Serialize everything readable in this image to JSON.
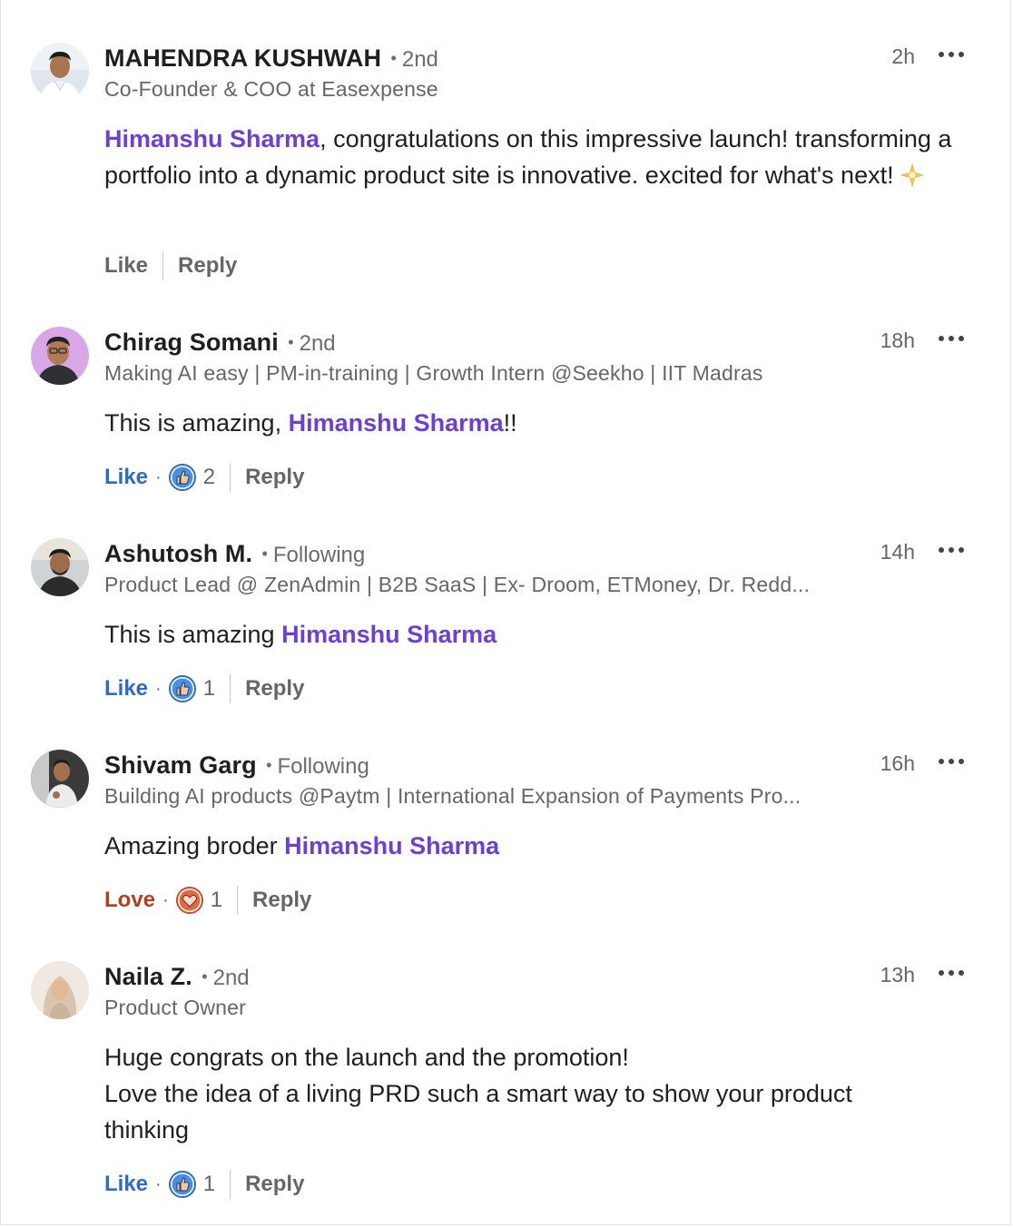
{
  "mention_name": "Himanshu Sharma",
  "colors": {
    "mention": "#6e3fd1",
    "like_active": "#2d6bc4",
    "love_active": "#b24020",
    "muted": "#666666"
  },
  "comments": [
    {
      "name": "MAHENDRA KUSHWAH",
      "degree": "2nd",
      "headline": "Co-Founder & COO at Easexpense",
      "time": "2h",
      "text_before": "",
      "text_after": ", congratulations on this impressive launch! transforming a portfolio into a dynamic product site is innovative. excited for what's next!",
      "emoji": "sparkle-star-icon",
      "reaction_label": "Like",
      "reaction_state": "none",
      "reaction_count": "",
      "reply_label": "Reply"
    },
    {
      "name": "Chirag Somani",
      "degree": "2nd",
      "headline": "Making AI easy | PM-in-training | Growth Intern @Seekho | IIT Madras",
      "time": "18h",
      "text_before": "This is amazing, ",
      "text_after": "!!",
      "reaction_label": "Like",
      "reaction_state": "like",
      "reaction_count": "2",
      "reply_label": "Reply"
    },
    {
      "name": "Ashutosh M.",
      "degree": "Following",
      "headline": "Product Lead @ ZenAdmin | B2B SaaS | Ex- Droom, ETMoney, Dr. Redd...",
      "time": "14h",
      "text_before": "This is amazing ",
      "text_after": "",
      "reaction_label": "Like",
      "reaction_state": "like",
      "reaction_count": "1",
      "reply_label": "Reply"
    },
    {
      "name": "Shivam Garg",
      "degree": "Following",
      "headline": "Building AI products @Paytm | International Expansion of Payments Pro...",
      "time": "16h",
      "text_before": "Amazing broder ",
      "text_after": "",
      "reaction_label": "Love",
      "reaction_state": "love",
      "reaction_count": "1",
      "reply_label": "Reply"
    },
    {
      "name": "Naila Z.",
      "degree": "2nd",
      "headline": "Product Owner",
      "time": "13h",
      "text_line1": "Huge congrats on the launch and the promotion!",
      "text_line2": "Love the idea of a living PRD such a smart way to show your product thinking",
      "reaction_label": "Like",
      "reaction_state": "like",
      "reaction_count": "1",
      "reply_label": "Reply"
    }
  ]
}
